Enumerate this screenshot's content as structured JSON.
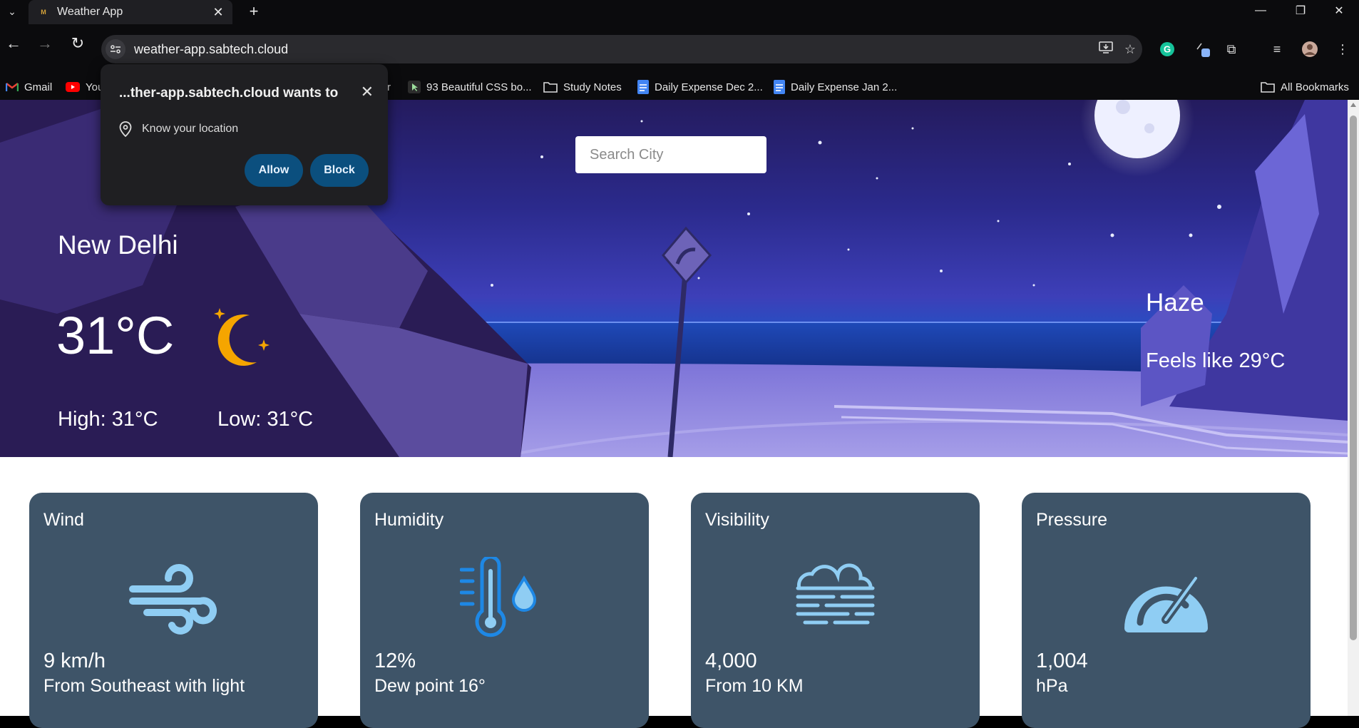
{
  "browser": {
    "tab_title": "Weather App",
    "url": "weather-app.sabtech.cloud",
    "bookmarks": [
      {
        "label": "Gmail"
      },
      {
        "label": "You"
      },
      {
        "label": "r"
      },
      {
        "label": "93 Beautiful CSS bo..."
      },
      {
        "label": "Study Notes"
      },
      {
        "label": "Daily Expense Dec 2..."
      },
      {
        "label": "Daily Expense Jan 2..."
      }
    ],
    "all_bookmarks": "All Bookmarks"
  },
  "permission_popup": {
    "title": "...ther-app.sabtech.cloud wants to",
    "permission": "Know your location",
    "allow_label": "Allow",
    "block_label": "Block"
  },
  "search": {
    "placeholder": "Search City"
  },
  "weather": {
    "city": "New Delhi",
    "temperature": "31°C",
    "high": "High: 31°C",
    "low": "Low: 31°C",
    "condition": "Haze",
    "feels_like": "Feels like 29°C"
  },
  "cards": [
    {
      "title": "Wind",
      "value": "9 km/h",
      "desc": "From Southeast with light",
      "icon": "wind-icon"
    },
    {
      "title": "Humidity",
      "value": "12%",
      "desc": "Dew point 16°",
      "icon": "humidity-icon"
    },
    {
      "title": "Visibility",
      "value": "4,000",
      "desc": "From 10 KM",
      "icon": "fog-icon"
    },
    {
      "title": "Pressure",
      "value": "1,004",
      "desc": "hPa",
      "icon": "gauge-icon"
    }
  ],
  "colors": {
    "card_bg": "#3e5468",
    "icon_blue": "#8fcdf3",
    "moon_orange": "#f5a500",
    "permission_button": "#0b4f7e"
  }
}
